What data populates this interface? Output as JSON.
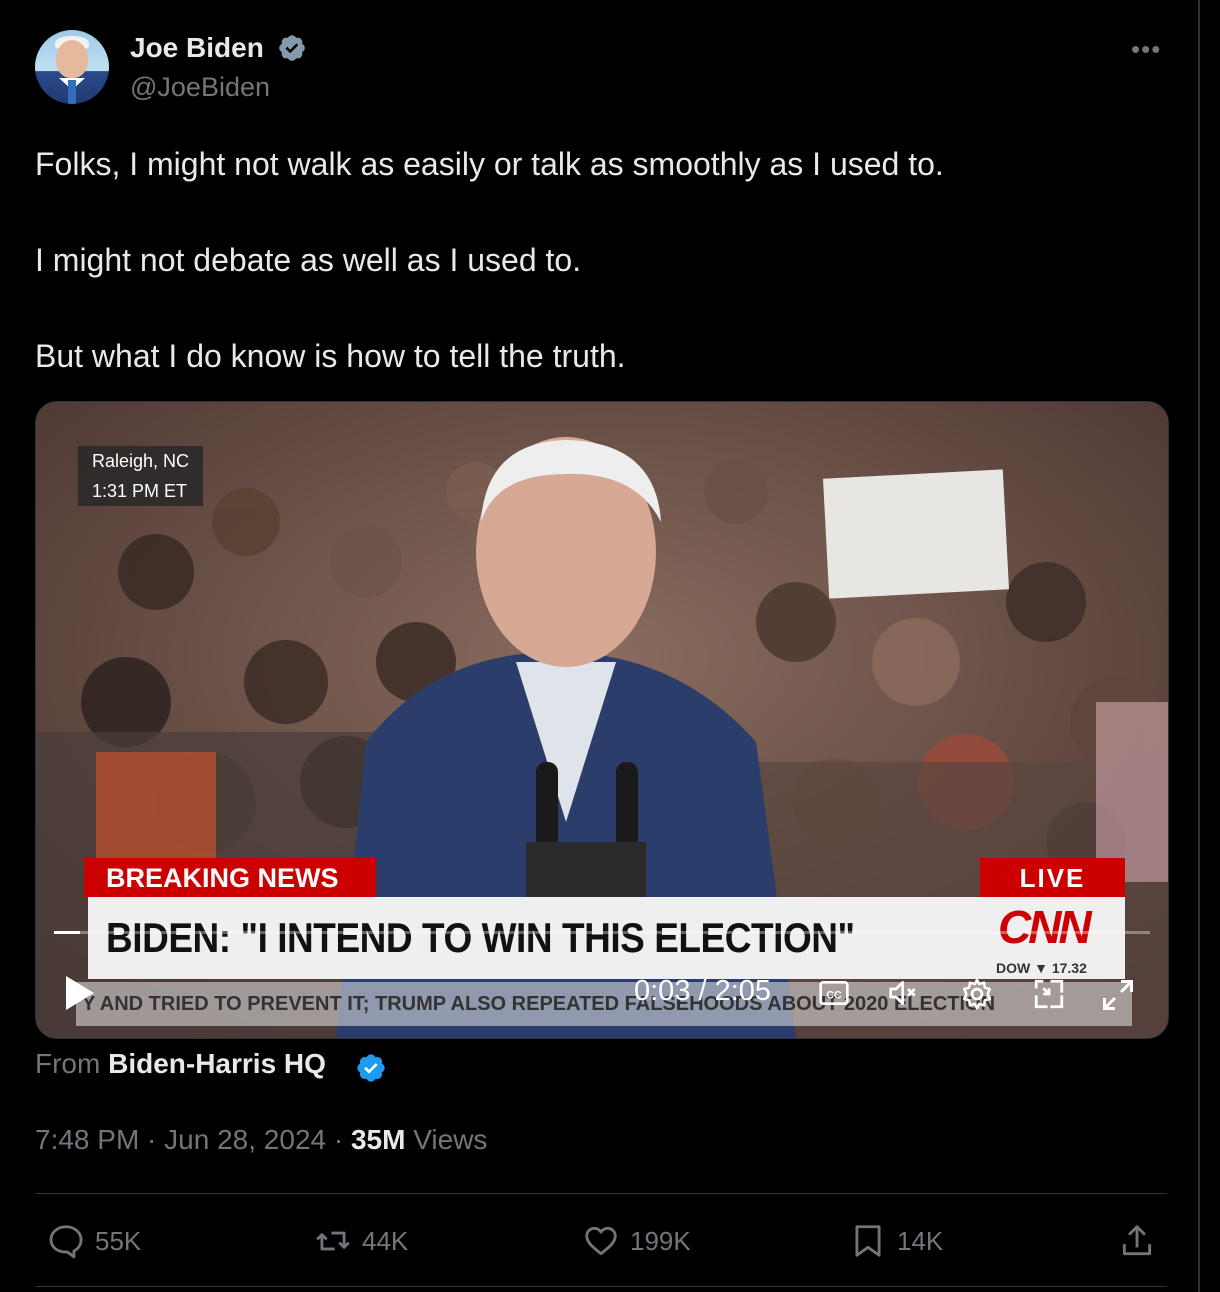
{
  "author": {
    "name": "Joe Biden",
    "handle": "@JoeBiden",
    "verified_color": "#829aab"
  },
  "more_icon": "more-dots-icon",
  "tweet": {
    "lines": [
      "Folks, I might not walk as easily or talk as smoothly as I used to.",
      "I might not debate as well as I used to.",
      "But what I do know is how to tell the truth."
    ]
  },
  "video": {
    "location": "Raleigh, NC",
    "local_time": "1:31 PM ET",
    "breaking_label": "BREAKING NEWS",
    "live_label": "LIVE",
    "headline": "BIDEN: \"I INTEND TO WIN THIS ELECTION\"",
    "network": "CNN",
    "dow": "DOW ▼ 17.32",
    "ticker": "Y AND TRIED TO PREVENT IT; TRUMP ALSO REPEATED FALSEHOODS ABOUT 2020 ELECTION",
    "timecode": "0:03 / 2:05",
    "progress": 0.024
  },
  "source": {
    "prefix": "From",
    "name": "Biden-Harris HQ",
    "verified_color": "#1d9bf0"
  },
  "meta": {
    "time": "7:48 PM",
    "sep1": " · ",
    "date": "Jun 28, 2024",
    "sep2": " · ",
    "views_count": "35M",
    "views_label": " Views"
  },
  "actions": {
    "replies": "55K",
    "reposts": "44K",
    "likes": "199K",
    "bookmarks": "14K"
  }
}
